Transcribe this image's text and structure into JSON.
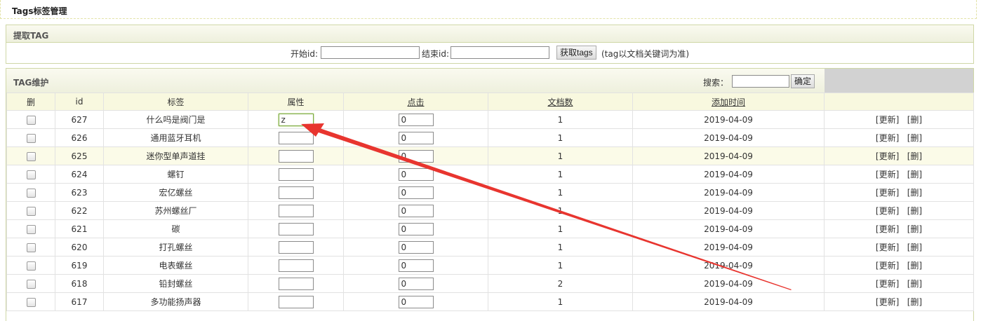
{
  "page_title": "Tags标签管理",
  "fetch_panel": {
    "title": "提取TAG",
    "start_label": "开始id:",
    "start_value": "",
    "end_label": "结束id:",
    "end_value": "",
    "fetch_button": "获取tags",
    "note": "(tag以文档关键词为准)"
  },
  "maint_panel": {
    "title": "TAG维护",
    "search_label": "搜索：",
    "search_value": "",
    "confirm_button": "确定"
  },
  "table": {
    "headers": [
      "删",
      "id",
      "标签",
      "属性",
      "点击",
      "文档数",
      "添加时间",
      ""
    ],
    "action_update": "[更新]",
    "action_delete": "[删]",
    "rows": [
      {
        "id": "627",
        "tag": "什么吗是阀门是",
        "attr": "z",
        "clicks": "0",
        "docs": "1",
        "date": "2019-04-09"
      },
      {
        "id": "626",
        "tag": "通用蓝牙耳机",
        "attr": "",
        "clicks": "0",
        "docs": "1",
        "date": "2019-04-09"
      },
      {
        "id": "625",
        "tag": "迷你型单声道挂",
        "attr": "",
        "clicks": "0",
        "docs": "1",
        "date": "2019-04-09"
      },
      {
        "id": "624",
        "tag": "螺钉",
        "attr": "",
        "clicks": "0",
        "docs": "1",
        "date": "2019-04-09"
      },
      {
        "id": "623",
        "tag": "宏亿螺丝",
        "attr": "",
        "clicks": "0",
        "docs": "1",
        "date": "2019-04-09"
      },
      {
        "id": "622",
        "tag": "苏州螺丝厂",
        "attr": "",
        "clicks": "0",
        "docs": "1",
        "date": "2019-04-09"
      },
      {
        "id": "621",
        "tag": "碳",
        "attr": "",
        "clicks": "0",
        "docs": "1",
        "date": "2019-04-09"
      },
      {
        "id": "620",
        "tag": "打孔螺丝",
        "attr": "",
        "clicks": "0",
        "docs": "1",
        "date": "2019-04-09"
      },
      {
        "id": "619",
        "tag": "电表螺丝",
        "attr": "",
        "clicks": "0",
        "docs": "1",
        "date": "2019-04-09"
      },
      {
        "id": "618",
        "tag": "铅封螺丝",
        "attr": "",
        "clicks": "0",
        "docs": "2",
        "date": "2019-04-09"
      },
      {
        "id": "617",
        "tag": "多功能扬声器",
        "attr": "",
        "clicks": "0",
        "docs": "1",
        "date": "2019-04-09"
      }
    ]
  },
  "colors": {
    "accent_arrow": "#e8352f",
    "header_bg": "#f8f8df",
    "panel_border": "#cfd7a6"
  }
}
